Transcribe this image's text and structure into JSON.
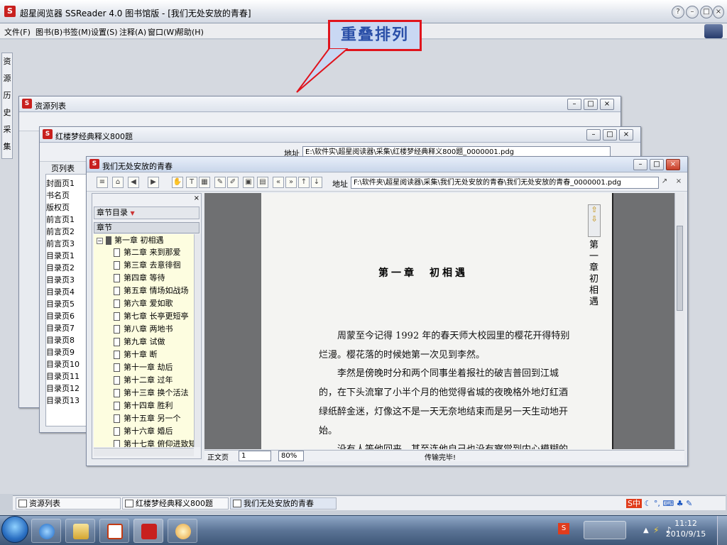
{
  "app": {
    "title": "超星阅览器 SSReader 4.0 图书馆版 - [我们无处安放的青春]",
    "menu": [
      "文件(F)",
      "图书(B)",
      "书签(M)",
      "设置(S)",
      "注释(A)",
      "窗口(W)",
      "帮助(H)"
    ],
    "side_tabs": [
      "资",
      "源",
      "历",
      "史",
      "采",
      "集"
    ]
  },
  "callout": {
    "text": "重叠排列"
  },
  "windows": {
    "resource_list": {
      "title": "资源列表"
    },
    "hongloumeng": {
      "title": "红楼梦经典释义800题",
      "addr_label": "地址",
      "addr_value": "E:\\软件实\\超星阅读器\\采集\\红楼梦经典释义800题_0000001.pdg",
      "page_list_label": "页列表",
      "pages": [
        "封面页1",
        "书名页",
        "版权页",
        "前言页1",
        "前言页2",
        "前言页3",
        "目录页1",
        "目录页2",
        "目录页3",
        "目录页4",
        "目录页5",
        "目录页6",
        "目录页7",
        "目录页8",
        "目录页9",
        "目录页10",
        "目录页11",
        "目录页12",
        "目录页13"
      ]
    },
    "front": {
      "title": "我们无处安放的青春",
      "addr_label": "地址",
      "addr_value": "F:\\软件夹\\超星阅读器\\采集\\我们无处安放的青春\\我们无处安放的青春_0000001.pdg",
      "chapter_pane": {
        "header": "章节目录",
        "column": "章节",
        "root": "第一章 初相遇",
        "items": [
          "第二章 来到那爱",
          "第三章 去意徘徊",
          "第四章 等待",
          "第五章 情场如战场",
          "第六章 爱如歌",
          "第七章 长亭更短亭",
          "第八章 两地书",
          "第九章 试做",
          "第十章 断",
          "第十一章 劫后",
          "第十二章 过年",
          "第十三章 换个活法",
          "第十四章 胜利",
          "第十五章 另一个",
          "第十六章 婚后",
          "第十七章 俯仰进致知"
        ]
      },
      "doc": {
        "chapter_heading": "第一章　初相遇",
        "vertical_title": "第一章　初相遇",
        "paragraphs": [
          "周蒙至今记得 1992 年的春天师大校园里的樱花开得特别烂漫。樱花落的时候她第一次见到李然。",
          "李然是傍晚时分和两个同事坐着报社的破吉普回到江城的，在下头流窜了小半个月的他觉得省城的夜晚格外地灯红酒绿纸醉金迷，灯像这不是一天无奈地结束而是另一天生动地开始。",
          "没有人等他回来，甚至连他自己也没有察觉到内心模糊的"
        ]
      },
      "status": {
        "page_label": "正文页",
        "page_value": "1",
        "zoom": "80%",
        "message": "传输完毕!"
      }
    }
  },
  "mdi_taskbar": [
    "资源列表",
    "红楼梦经典释义800题",
    "我们无处安放的青春"
  ],
  "os": {
    "time": "11:12",
    "date": "2010/9/15",
    "ime": "S中"
  }
}
